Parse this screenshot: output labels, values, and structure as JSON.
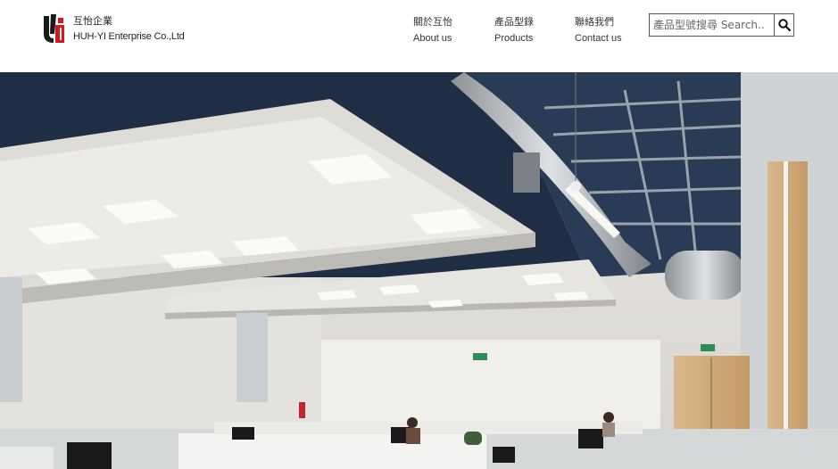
{
  "brand": {
    "name_zh": "互怡企業",
    "name_en": "HUH-YI Enterprise Co.,Ltd",
    "colors": {
      "primary": "#d7171f",
      "dark": "#1a1a1a"
    }
  },
  "nav": [
    {
      "label_zh": "關於互怡",
      "label_en": "About us"
    },
    {
      "label_zh": "產品型錄",
      "label_en": "Products"
    },
    {
      "label_zh": "聯絡我們",
      "label_en": "Contact us"
    }
  ],
  "search": {
    "placeholder": "產品型號搜尋 Search..",
    "value": "",
    "icon": "search-icon"
  },
  "hero": {
    "image": "office-interior-photo"
  }
}
